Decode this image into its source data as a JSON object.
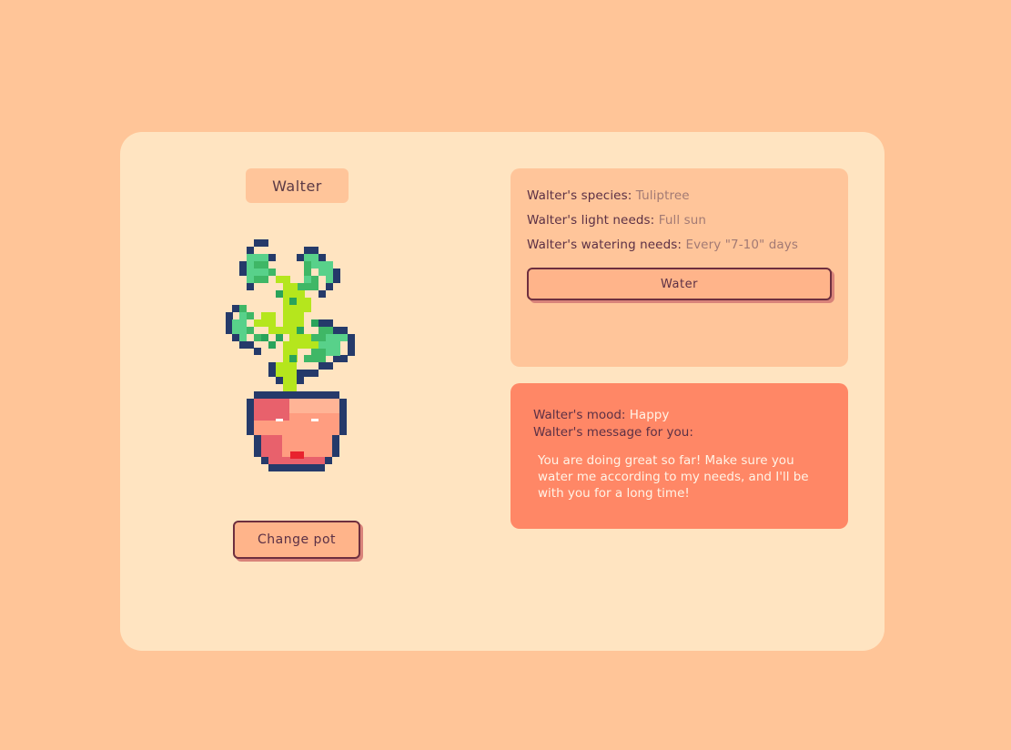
{
  "plant": {
    "name": "Walter",
    "change_pot_label": "Change pot"
  },
  "info": {
    "species_label": "Walter's species:",
    "species_value": "Tuliptree",
    "light_label": "Walter's light needs:",
    "light_value": "Full sun",
    "watering_label": "Walter's watering needs:",
    "watering_value": "Every \"7-10\" days",
    "water_button_label": "Water"
  },
  "mood": {
    "mood_label": "Walter's mood:",
    "mood_value": "Happy",
    "message_label": "Walter's message for you:",
    "message_text": "You are doing great so far! Make sure you water me according to my needs, and I'll be with you for a long time!"
  },
  "colors": {
    "background": "#ffc598",
    "card": "#ffe4c1",
    "panel": "#ffc59a",
    "mood_panel": "#ff8766",
    "button": "#ffb48a",
    "button_border": "#6e2f3f",
    "text_dark": "#5b3045",
    "text_muted": "#a27a74",
    "text_light": "#fff3e6"
  },
  "icons": {
    "plant": "pixel-plant-in-pot-icon"
  }
}
